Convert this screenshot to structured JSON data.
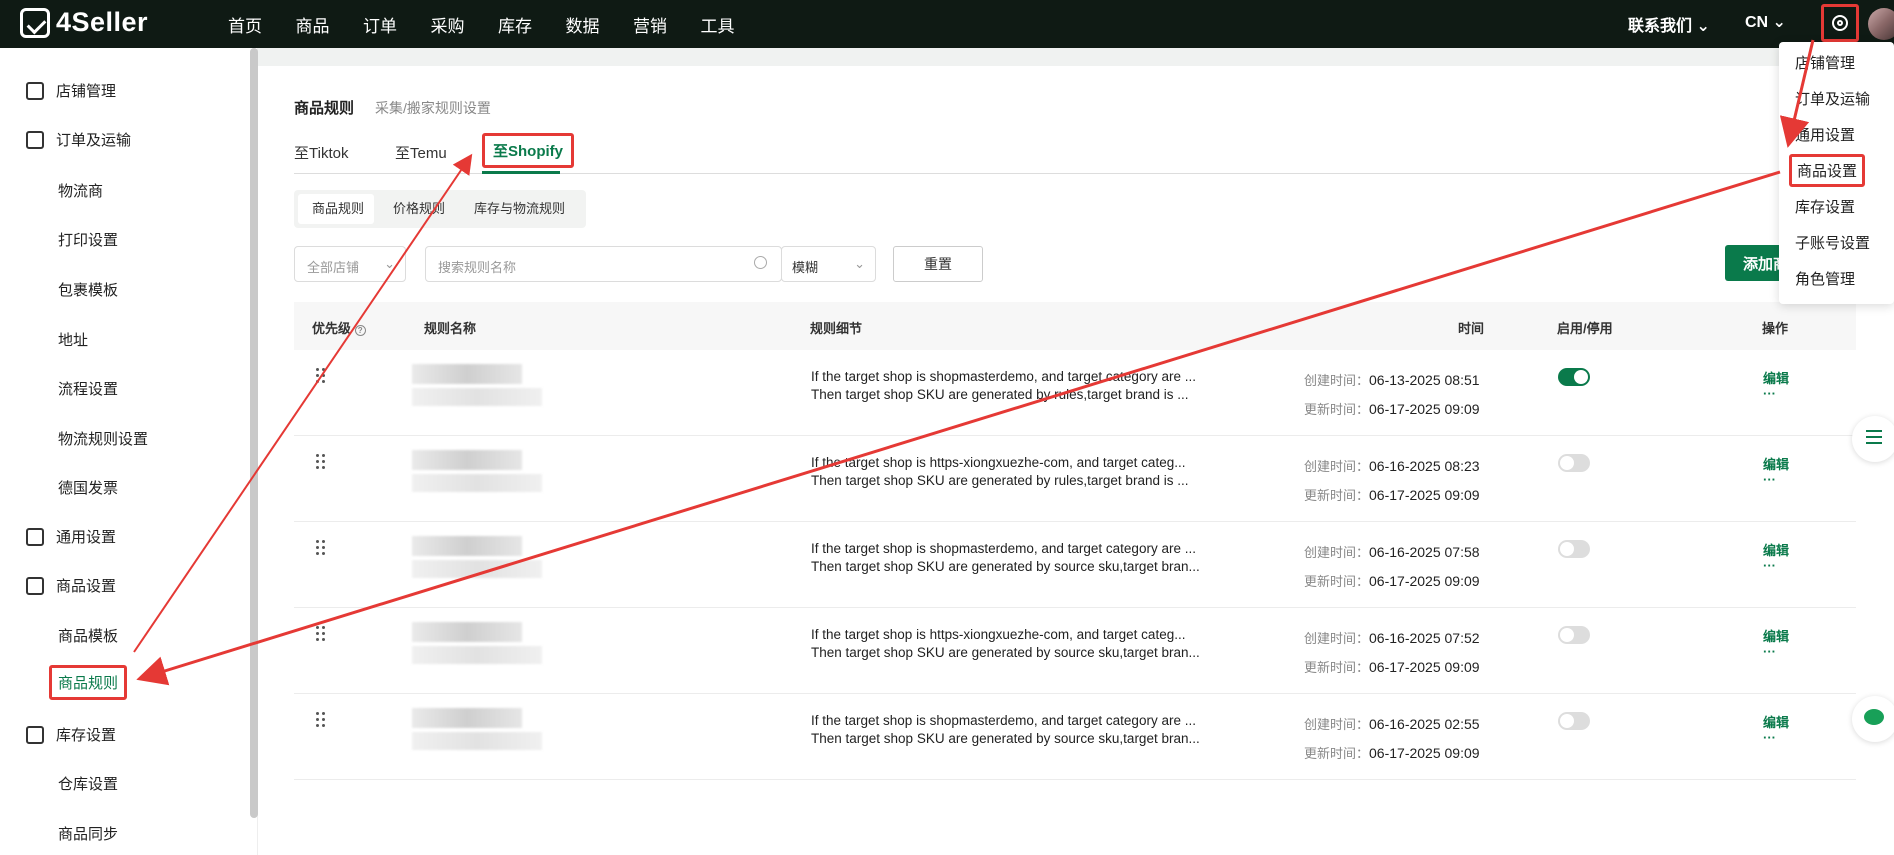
{
  "topbar": {
    "logo_text": "4Seller",
    "nav": [
      "首页",
      "商品",
      "订单",
      "采购",
      "库存",
      "数据",
      "营销",
      "工具"
    ],
    "contact": "联系我们 ⌄",
    "lang": "CN ⌄"
  },
  "sidebar": {
    "shop_mgmt": "店铺管理",
    "order_shipping": "订单及运输",
    "carrier": "物流商",
    "print_settings": "打印设置",
    "package_template": "包裹模板",
    "address": "地址",
    "flow_settings": "流程设置",
    "logistics_rules": "物流规则设置",
    "german_invoice": "德国发票",
    "general_settings": "通用设置",
    "product_settings": "商品设置",
    "product_template": "商品模板",
    "product_rules": "商品规则",
    "inventory_settings": "库存设置",
    "warehouse_settings": "仓库设置",
    "product_sync": "商品同步"
  },
  "page": {
    "title": "商品规则",
    "subtitle": "采集/搬家规则设置",
    "tabs": [
      "至Tiktok",
      "至Temu",
      "至Shopify"
    ],
    "subtabs": [
      "商品规则",
      "价格规则",
      "库存与物流规则"
    ],
    "store_filter": "全部店铺",
    "search_placeholder": "搜索规则名称",
    "match_mode": "模糊",
    "reset": "重置",
    "add": "添加商"
  },
  "table": {
    "headers": {
      "priority": "优先级",
      "name": "规则名称",
      "detail": "规则细节",
      "time": "时间",
      "status": "启用/停用",
      "action": "操作"
    },
    "created_label": "创建时间：",
    "updated_label": "更新时间：",
    "edit": "编辑",
    "more": "···",
    "rows": [
      {
        "line1": "If the target shop is shopmasterdemo, and target category are ...",
        "line2": "Then target shop SKU are generated by rules,target brand is ...",
        "created": "06-13-2025 08:51",
        "updated": "06-17-2025 09:09",
        "enabled": true
      },
      {
        "line1": "If the target shop is https-xiongxuezhe-com, and target categ...",
        "line2": "Then target shop SKU are generated by rules,target brand is ...",
        "created": "06-16-2025 08:23",
        "updated": "06-17-2025 09:09",
        "enabled": false
      },
      {
        "line1": "If the target shop is shopmasterdemo, and target category are ...",
        "line2": "Then target shop SKU are generated by source sku,target bran...",
        "created": "06-16-2025 07:58",
        "updated": "06-17-2025 09:09",
        "enabled": false
      },
      {
        "line1": "If the target shop is https-xiongxuezhe-com, and target categ...",
        "line2": "Then target shop SKU are generated by source sku,target bran...",
        "created": "06-16-2025 07:52",
        "updated": "06-17-2025 09:09",
        "enabled": false
      },
      {
        "line1": "If the target shop is shopmasterdemo, and target category are ...",
        "line2": "Then target shop SKU are generated by source sku,target bran...",
        "created": "06-16-2025 02:55",
        "updated": "06-17-2025 09:09",
        "enabled": false
      }
    ]
  },
  "settings_menu": [
    "店铺管理",
    "订单及运输",
    "通用设置",
    "商品设置",
    "库存设置",
    "子账号设置",
    "角色管理"
  ],
  "colors": {
    "accent": "#0a7a4b",
    "annotation": "#e53935",
    "topbar": "#0f1a14"
  }
}
